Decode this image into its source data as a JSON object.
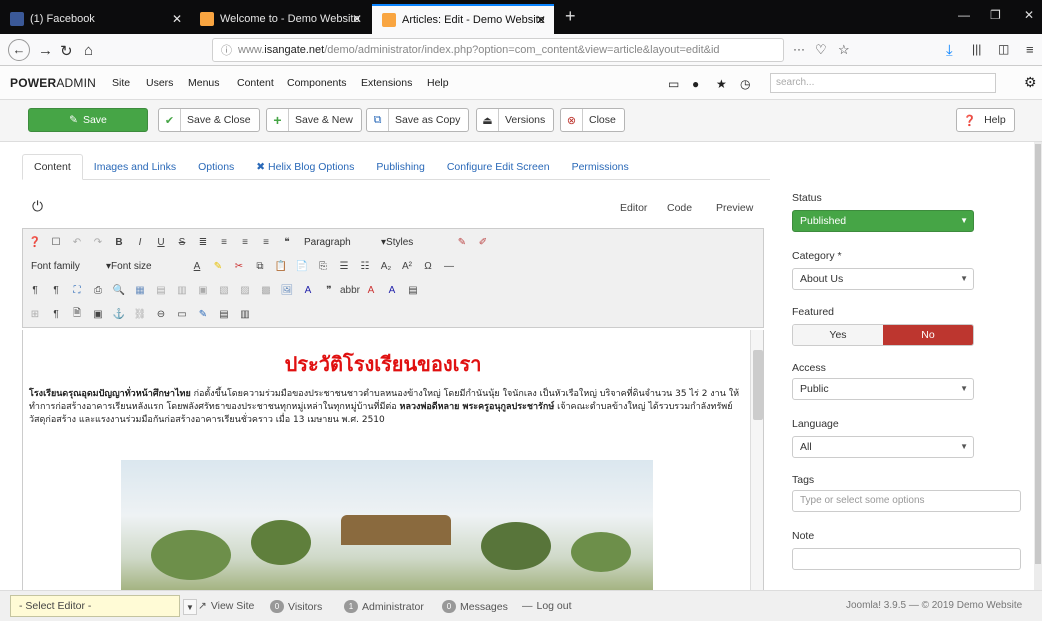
{
  "browser": {
    "tabs": [
      {
        "title": "(1) Facebook",
        "color": "#3b5998"
      },
      {
        "title": "Welcome to - Demo Website",
        "color": "#f9a541"
      },
      {
        "title": "Articles: Edit - Demo Website -",
        "color": "#f9a541"
      }
    ],
    "url_prefix": "www.",
    "url_domain": "isangate.net",
    "url_rest": "/demo/administrator/index.php?option=com_content&view=article&layout=edit&id"
  },
  "admin": {
    "logo_bold": "POWER",
    "logo_rest": "ADMIN",
    "menu": [
      "Site",
      "Users",
      "Menus",
      "Content",
      "Components",
      "Extensions",
      "Help"
    ],
    "search_placeholder": "search..."
  },
  "toolbar": {
    "save": "Save",
    "save_close": "Save & Close",
    "save_new": "Save & New",
    "save_copy": "Save as Copy",
    "versions": "Versions",
    "close": "Close",
    "help": "Help"
  },
  "subtabs": [
    "Content",
    "Images and Links",
    "Options",
    "Helix Blog Options",
    "Publishing",
    "Configure Edit Screen",
    "Permissions"
  ],
  "editor": {
    "tabs": [
      "Editor",
      "Code",
      "Preview"
    ],
    "format_select": "Paragraph",
    "styles_select": "Styles",
    "font_family": "Font family",
    "font_size": "Font size",
    "title": "ประวัติโรงเรียนของเรา",
    "body_bold1": "โรงเรียนดรุณอุดมปัญญาทั่วหน้าศึกษาไทย",
    "body1": " ก่อตั้งขึ้นโดยความร่วมมือของประชาชนชาวตำบลหนองข้างใหญ่ โดยมีกำนันนุ้ย ใจนักเลง เป็นหัวเรือใหญ่ บริจาคที่ดินจำนวน 35 ไร่ 2 งาน ให้ทำการก่อสร้างอาคารเรียนหลังแรก โดยพลังศรัทธาของประชาชนทุกหมู่เหล่าในทุกหมู่บ้านที่มีต่อ ",
    "body_bold2": "หลวงพ่อดีหลาย พระครูอนุกูลประชารักษ์",
    "body2": " เจ้าคณะตำบลข้างใหญ่ ได้รวบรวมกำลังทรัพย์ วัสดุก่อสร้าง และแรงงานร่วมมือกันก่อสร้างอาคารเรียนชั่วคราว เมื่อ 13 เมษายน พ.ศ. 2510"
  },
  "sidebar": {
    "status_label": "Status",
    "status_value": "Published",
    "category_label": "Category *",
    "category_value": "About Us",
    "featured_label": "Featured",
    "featured_yes": "Yes",
    "featured_no": "No",
    "access_label": "Access",
    "access_value": "Public",
    "language_label": "Language",
    "language_value": "All",
    "tags_label": "Tags",
    "tags_placeholder": "Type or select some options",
    "note_label": "Note"
  },
  "footer": {
    "select_editor": "- Select Editor -",
    "view_site": "View Site",
    "visitors_count": "0",
    "visitors": "Visitors",
    "admin_count": "1",
    "administrator": "Administrator",
    "messages_count": "0",
    "messages": "Messages",
    "logout": "Log out",
    "copyright": "Joomla! 3.9.5 — © 2019 Demo Website"
  },
  "colors": {
    "green": "#46a546",
    "red": "#bd362f",
    "link": "#2a69b8"
  }
}
